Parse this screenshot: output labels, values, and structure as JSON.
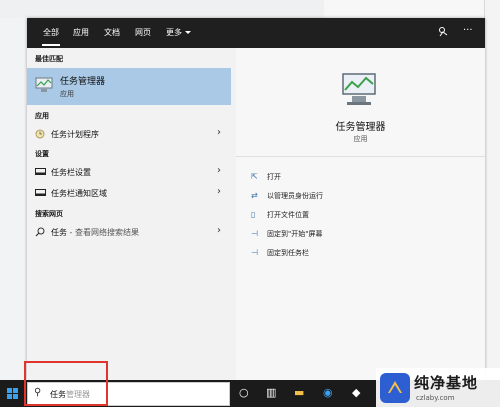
{
  "tabs": [
    {
      "label": "全部",
      "active": true
    },
    {
      "label": "应用"
    },
    {
      "label": "文档"
    },
    {
      "label": "网页"
    },
    {
      "label": "更多"
    }
  ],
  "top_icons": {
    "feedback": "feedback-icon",
    "more": "···"
  },
  "sections": {
    "best_match": "最佳匹配",
    "apps": "应用",
    "settings": "设置",
    "web": "搜索网页"
  },
  "best_match": {
    "title": "任务管理器",
    "subtitle": "应用",
    "icon": "task-manager-icon"
  },
  "apps": [
    {
      "label": "任务计划程序",
      "icon": "task-scheduler-icon"
    }
  ],
  "settings": [
    {
      "label": "任务栏设置",
      "icon": "taskbar-icon"
    },
    {
      "label": "任务栏通知区域",
      "icon": "taskbar-icon"
    }
  ],
  "web": {
    "label": "任务",
    "suffix": " - 查看网络搜索结果",
    "icon": "search-icon"
  },
  "detail": {
    "title": "任务管理器",
    "subtitle": "应用",
    "actions": [
      {
        "label": "打开",
        "icon": "open-icon"
      },
      {
        "label": "以管理员身份运行",
        "icon": "run-as-admin-icon"
      },
      {
        "label": "打开文件位置",
        "icon": "file-location-icon"
      },
      {
        "label": "固定到\"开始\"屏幕",
        "icon": "pin-icon"
      },
      {
        "label": "固定到任务栏",
        "icon": "pin-icon"
      }
    ]
  },
  "taskbar": {
    "search_typed": "任务",
    "search_suggestion": "管理器"
  },
  "watermark": {
    "title": "纯净基地",
    "subtitle": "czlaby.com"
  },
  "colors": {
    "accent": "#a9c9e6",
    "topbar": "#1f1f1f",
    "highlight_box": "#e0342e",
    "taskbar": "#1b1b1b"
  }
}
